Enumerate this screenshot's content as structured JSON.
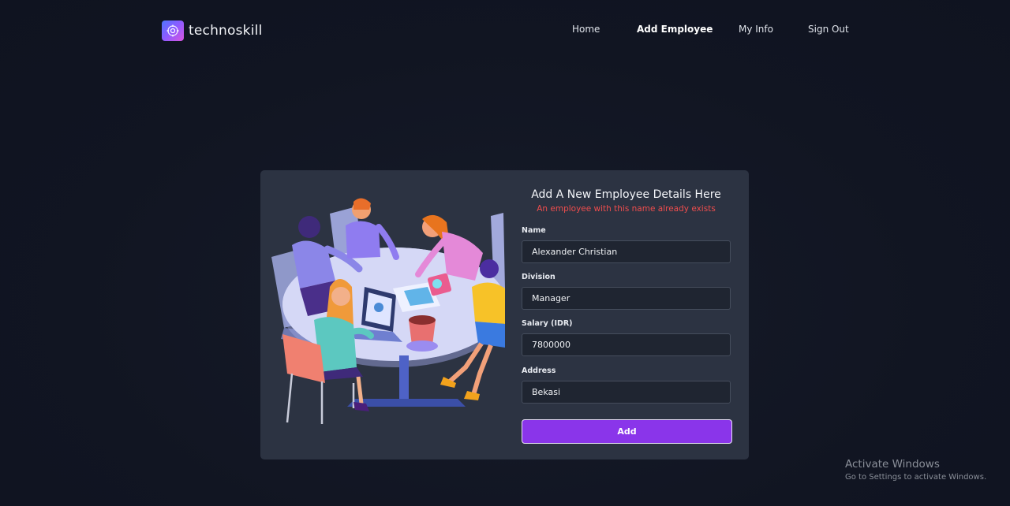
{
  "nav": {
    "brand": "technoskill",
    "items": [
      {
        "label": "Home",
        "active": false
      },
      {
        "label": "Add Employee",
        "active": true
      },
      {
        "label": "My Info",
        "active": false
      },
      {
        "label": "Sign Out",
        "active": false
      }
    ]
  },
  "form": {
    "title": "Add A New Employee Details Here",
    "error": "An employee with this name already exists",
    "fields": [
      {
        "label": "Name",
        "value": "Alexander Christian"
      },
      {
        "label": "Division",
        "value": "Manager"
      },
      {
        "label": "Salary (IDR)",
        "value": "7800000"
      },
      {
        "label": "Address",
        "value": "Bekasi"
      }
    ],
    "submit_label": "Add"
  },
  "watermark": {
    "title": "Activate Windows",
    "subtitle": "Go to Settings to activate Windows."
  },
  "colors": {
    "accent": "#8a35ea",
    "error": "#ef4d4d",
    "card": "#2c3342",
    "background": "#111522"
  }
}
